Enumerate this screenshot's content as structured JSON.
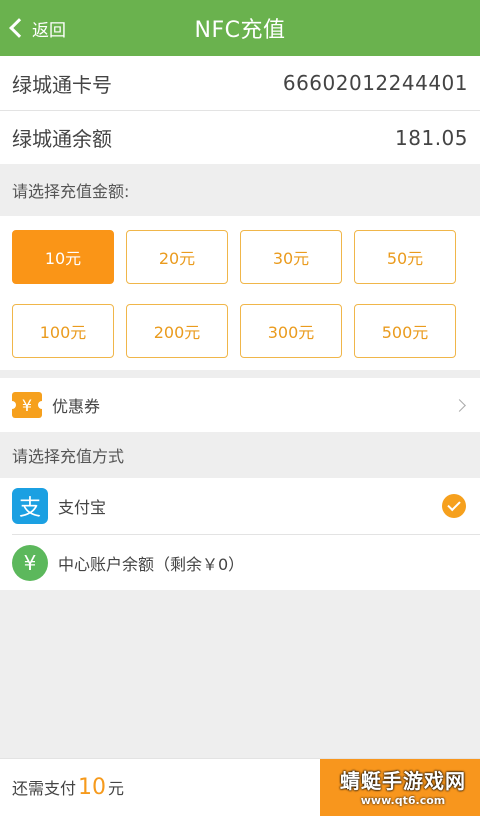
{
  "header": {
    "back_label": "返回",
    "title": "NFC充值"
  },
  "card_info": {
    "card_number_label": "绿城通卡号",
    "card_number_value": "66602012244401",
    "balance_label": "绿城通余额",
    "balance_value": "181.05"
  },
  "amount_section": {
    "label": "请选择充值金额:",
    "selected_index": 0,
    "options": [
      "10元",
      "20元",
      "30元",
      "50元",
      "100元",
      "200元",
      "300元",
      "500元"
    ]
  },
  "coupon": {
    "icon_glyph": "¥",
    "label": "优惠券"
  },
  "payment_section": {
    "label": "请选择充值方式",
    "methods": [
      {
        "icon_glyph": "支",
        "label": "支付宝",
        "selected": true
      },
      {
        "icon_glyph": "¥",
        "label": "中心账户余额（剩余￥0）",
        "selected": false
      }
    ]
  },
  "footer": {
    "due_label": "还需支付",
    "due_amount": "10",
    "due_unit": "元"
  },
  "watermark": {
    "main": "蜻蜓手游戏网",
    "sub": "www.qt6.com"
  },
  "colors": {
    "header_green": "#6ab24e",
    "accent_orange": "#fa9517",
    "alipay_blue": "#1ba0e2",
    "account_green": "#5cb85c"
  }
}
